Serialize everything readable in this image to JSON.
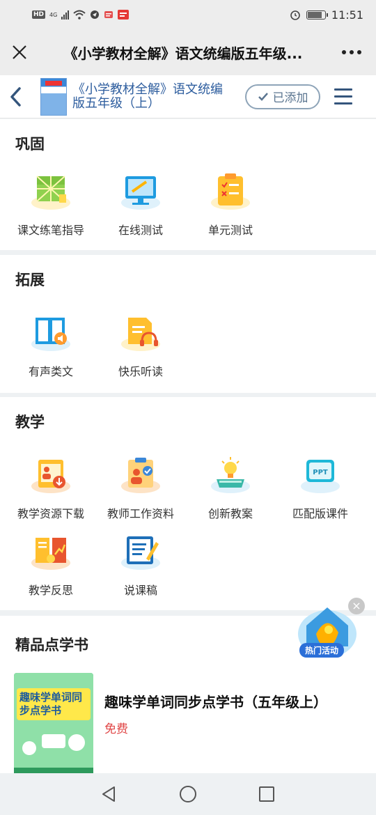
{
  "status_bar": {
    "left_chips": [
      "HD",
      "4G"
    ],
    "time": "11:51",
    "battery_level": 0.85
  },
  "wechat_bar": {
    "title": "《小学教材全解》语文统编版五年级..."
  },
  "header": {
    "title": "《小学教材全解》语文统编版五年级（上）",
    "added_label": "已添加"
  },
  "sections": [
    {
      "title": "巩固",
      "items": [
        {
          "label": "课文练笔指导",
          "icon": "grid-note-icon"
        },
        {
          "label": "在线测试",
          "icon": "monitor-icon"
        },
        {
          "label": "单元测试",
          "icon": "clipboard-icon"
        }
      ]
    },
    {
      "title": "拓展",
      "items": [
        {
          "label": "有声类文",
          "icon": "audio-book-icon"
        },
        {
          "label": "快乐听读",
          "icon": "headphone-doc-icon"
        }
      ]
    },
    {
      "title": "教学",
      "items": [
        {
          "label": "教学资源下载",
          "icon": "resource-download-icon"
        },
        {
          "label": "教师工作资料",
          "icon": "teacher-doc-icon"
        },
        {
          "label": "创新教案",
          "icon": "lightbulb-book-icon"
        },
        {
          "label": "匹配版课件",
          "icon": "ppt-icon"
        },
        {
          "label": "教学反思",
          "icon": "reflection-book-icon"
        },
        {
          "label": "说课稿",
          "icon": "edit-doc-icon"
        }
      ]
    }
  ],
  "featured": {
    "title": "精品点学书",
    "book_title": "趣味学单词同步点学书（五年级上）",
    "price": "免费",
    "cover_text": "趣味学单词同步点学书"
  },
  "promo": {
    "label": "热门活动"
  }
}
